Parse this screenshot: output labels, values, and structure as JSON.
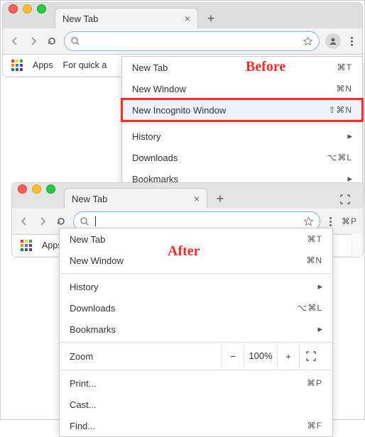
{
  "callouts": {
    "before": {
      "text": "Before",
      "color": "#ff2a2a"
    },
    "after": {
      "text": "After",
      "color": "#ff2a2a"
    }
  },
  "before": {
    "tab_title": "New Tab",
    "bookmarks_bar": {
      "apps_label": "Apps",
      "quick_label": "For quick a"
    },
    "menu": {
      "new_tab": {
        "label": "New Tab",
        "shortcut": "⌘T"
      },
      "new_window": {
        "label": "New Window",
        "shortcut": "⌘N"
      },
      "incognito": {
        "label": "New Incognito Window",
        "shortcut": "⇧⌘N"
      },
      "history": {
        "label": "History"
      },
      "downloads": {
        "label": "Downloads",
        "shortcut": "⌥⌘L"
      },
      "bookmarks": {
        "label": "Bookmarks"
      }
    }
  },
  "after": {
    "tab_title": "New Tab",
    "bookmarks_bar": {
      "apps_label": "Apps"
    },
    "menu": {
      "new_tab": {
        "label": "New Tab",
        "shortcut": "⌘T"
      },
      "new_window": {
        "label": "New Window",
        "shortcut": "⌘N"
      },
      "history": {
        "label": "History"
      },
      "downloads": {
        "label": "Downloads",
        "shortcut": "⌥⌘L"
      },
      "bookmarks": {
        "label": "Bookmarks"
      },
      "zoom": {
        "label": "Zoom",
        "value": "100%"
      },
      "print": {
        "label": "Print...",
        "shortcut": "⌘P"
      },
      "cast": {
        "label": "Cast..."
      },
      "find": {
        "label": "Find...",
        "shortcut": "⌘F"
      }
    },
    "side_shortcut": "⌘P"
  }
}
